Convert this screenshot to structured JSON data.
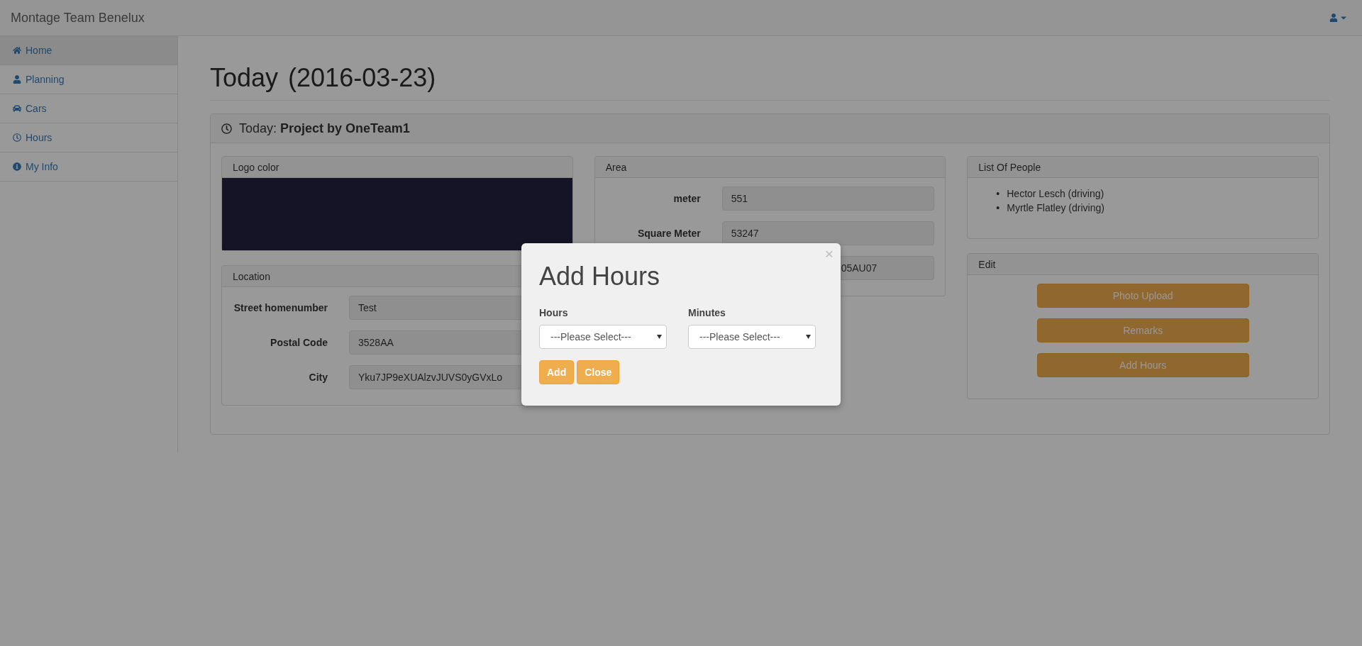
{
  "navbar": {
    "brand": "Montage Team Benelux"
  },
  "sidebar": {
    "items": [
      {
        "label": "Home",
        "selected": true
      },
      {
        "label": "Planning",
        "selected": false
      },
      {
        "label": "Cars",
        "selected": false
      },
      {
        "label": "Hours",
        "selected": false
      },
      {
        "label": "My Info",
        "selected": false
      }
    ]
  },
  "page_title": {
    "text": "Today",
    "date": "(2016-03-23)"
  },
  "project_panel": {
    "heading": "Today: **Project by OneTeam1**",
    "logo": {
      "title": "Logo color",
      "color": "#151426"
    },
    "location": {
      "title": "Location",
      "fields": [
        {
          "label": "Street homenumber",
          "value": "Test"
        },
        {
          "label": "Postal Code",
          "value": "3528AA"
        },
        {
          "label": "City",
          "value": "Yku7JP9eXUAlzvJUVS0yGVxLo"
        }
      ]
    },
    "area": {
      "title": "Area",
      "fields": [
        {
          "label": "meter",
          "value": "551",
          "covered": false
        },
        {
          "label": "Square Meter",
          "value": "53247",
          "covered": false
        },
        {
          "value": "05AU07",
          "covered": true
        }
      ]
    },
    "people": {
      "title": "List Of People",
      "items": [
        {
          "bullet": "•",
          "text": "Hector Lesch (driving)"
        },
        {
          "bullet": "•",
          "text": "Myrtle Flatley (driving)"
        }
      ]
    },
    "edit": {
      "title": "Edit",
      "buttons": [
        "Photo Upload",
        "Remarks",
        "Add Hours"
      ]
    }
  },
  "modal": {
    "close": "×",
    "title": "Add Hours",
    "selects": [
      {
        "label": "Hours",
        "value": "---Please Select---"
      },
      {
        "label": "Minutes",
        "value": "---Please Select---"
      }
    ],
    "buttons": [
      "Add",
      "Close"
    ]
  }
}
